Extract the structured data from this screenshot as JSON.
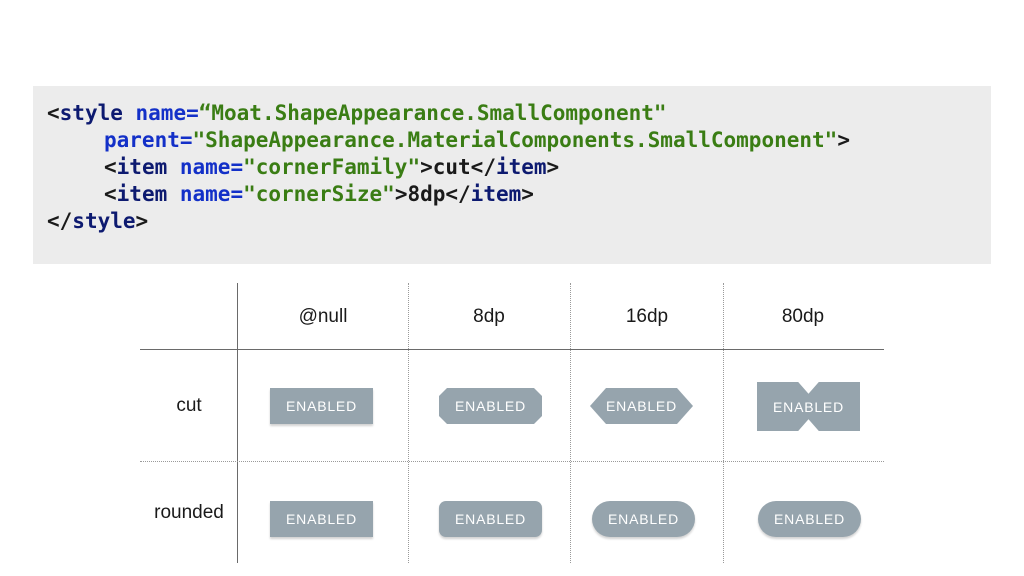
{
  "code": {
    "l1_open": "<",
    "l1_tag": "style",
    "l1_attr": " name=",
    "l1_val": "“Moat.ShapeAppearance.SmallComponent\"",
    "l2_attr": "parent=",
    "l2_val": "\"ShapeAppearance.MaterialComponents.SmallComponent\"",
    "l2_close": ">",
    "l3_open": "<",
    "l3_tag": "item",
    "l3_attr": " name=",
    "l3_val": "\"cornerFamily\"",
    "l3_text": ">cut</",
    "l3_tag2": "item",
    "l3_close": ">",
    "l4_open": "<",
    "l4_tag": "item",
    "l4_attr": " name=",
    "l4_val": "\"cornerSize\"",
    "l4_text": ">8dp</",
    "l4_tag2": "item",
    "l4_close": ">",
    "l5_open": "</",
    "l5_tag": "style",
    "l5_close": ">"
  },
  "table": {
    "columns": [
      "@null",
      "8dp",
      "16dp",
      "80dp"
    ],
    "rows": [
      "cut",
      "rounded"
    ],
    "button_label": "ENABLED"
  },
  "colors": {
    "button_fill": "#96a4ad",
    "code_background": "#ececec",
    "code_tag": "#0d1a70",
    "code_attr": "#1330c8",
    "code_string": "#3a7d14"
  }
}
